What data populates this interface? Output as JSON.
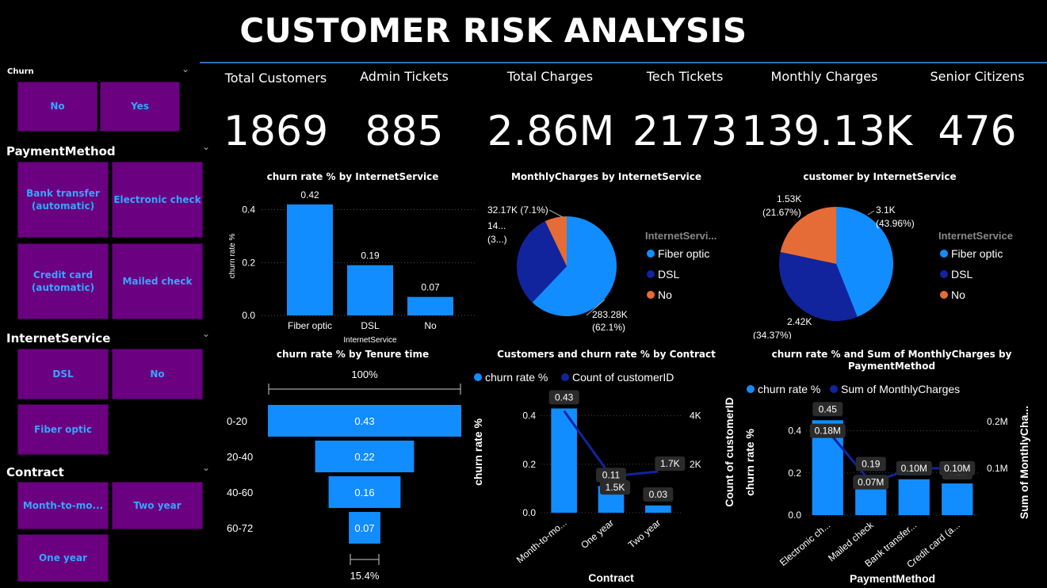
{
  "title": "CUSTOMER RISK ANALYSIS",
  "slicers": {
    "churn": {
      "title": "Churn",
      "items": [
        "No",
        "Yes"
      ]
    },
    "payment": {
      "title": "PaymentMethod",
      "items": [
        "Bank transfer (automatic)",
        "Electronic check",
        "Credit card (automatic)",
        "Mailed check"
      ]
    },
    "internet": {
      "title": "InternetService",
      "items": [
        "DSL",
        "No",
        "Fiber optic"
      ]
    },
    "contract": {
      "title": "Contract",
      "items": [
        "Month-to-mo...",
        "Two year",
        "One year"
      ]
    }
  },
  "kpis": [
    {
      "label": "Total Customers",
      "value": "1869"
    },
    {
      "label": "Admin Tickets",
      "value": "885"
    },
    {
      "label": "Total Charges",
      "value": "2.86M"
    },
    {
      "label": "Tech Tickets",
      "value": "2173"
    },
    {
      "label": "Monthly Charges",
      "value": "139.13K"
    },
    {
      "label": "Senior Citizens",
      "value": "476"
    }
  ],
  "colors": {
    "accent": "#118dff",
    "dark_blue": "#12239e",
    "orange": "#e66c37",
    "slicer_bg": "#6b0080",
    "slicer_text": "#35a6ff",
    "line": "#2f6fb3"
  },
  "chart_data": [
    {
      "type": "bar",
      "title": "churn rate % by InternetService",
      "xlabel": "InternetService",
      "ylabel": "churn rate %",
      "categories": [
        "Fiber optic",
        "DSL",
        "No"
      ],
      "values": [
        0.42,
        0.19,
        0.07
      ],
      "value_labels": [
        "0.42",
        "0.19",
        "0.07"
      ],
      "yticks": [
        "0.0",
        "0.2",
        "0.4"
      ],
      "ylim": [
        0,
        0.45
      ]
    },
    {
      "type": "pie",
      "title": "MonthlyCharges by InternetService",
      "legend_title": "InternetServi...",
      "categories": [
        "Fiber optic",
        "DSL",
        "No"
      ],
      "values": [
        283.28,
        14.0,
        32.17
      ],
      "value_labels": [
        "283.28K (62.1%)",
        "14... (3...)",
        "32.17K (7.1%)"
      ],
      "label_lines": [
        [
          "283.28K",
          "(62.1%)"
        ],
        [
          "14...",
          "(3...)"
        ],
        [
          "32.17K (7.1%)"
        ]
      ],
      "slice_fractions": [
        0.621,
        0.308,
        0.071
      ]
    },
    {
      "type": "pie",
      "title": "customer by InternetService",
      "legend_title": "InternetService",
      "categories": [
        "Fiber optic",
        "DSL",
        "No"
      ],
      "values": [
        3.1,
        2.42,
        1.53
      ],
      "value_labels": [
        "3.1K (43.96%)",
        "2.42K (34.37%)",
        "1.53K (21.67%)"
      ],
      "label_lines": [
        [
          "3.1K",
          "(43.96%)"
        ],
        [
          "2.42K",
          "(34.37%)"
        ],
        [
          "1.53K",
          "(21.67%)"
        ]
      ],
      "slice_fractions": [
        0.4396,
        0.3437,
        0.2167
      ]
    },
    {
      "type": "bar",
      "subtype": "funnel",
      "title": "churn rate % by Tenure time",
      "categories": [
        "0-20",
        "20-40",
        "40-60",
        "60-72"
      ],
      "values": [
        0.43,
        0.22,
        0.16,
        0.07
      ],
      "value_labels": [
        "0.43",
        "0.22",
        "0.16",
        "0.07"
      ],
      "top_label": "100%",
      "bottom_label": "15.4%"
    },
    {
      "type": "bar",
      "subtype": "combo",
      "title": "Customers and churn rate % by Contract",
      "xlabel": "Contract",
      "ylabel": "churn rate %",
      "y2label": "Count of customerID",
      "legend": [
        "churn rate %",
        "Count of customerID"
      ],
      "categories": [
        "Month-to-mo...",
        "One year",
        "Two year"
      ],
      "series": [
        {
          "name": "churn rate %",
          "values": [
            0.43,
            0.11,
            0.03
          ],
          "labels": [
            "0.43",
            "0.11",
            "0.03"
          ]
        },
        {
          "name": "Count of customerID",
          "values": [
            4.2,
            1.5,
            1.7
          ],
          "labels": [
            "",
            "1.5K",
            "1.7K"
          ]
        }
      ],
      "yticks": [
        "0.0",
        "0.2",
        "0.4"
      ],
      "y2ticks": [
        "2K",
        "4K"
      ],
      "ylim": [
        0,
        0.5
      ],
      "y2lim": [
        0,
        5
      ]
    },
    {
      "type": "bar",
      "subtype": "combo",
      "title": "churn rate % and Sum of MonthlyCharges by PaymentMethod",
      "title_lines": [
        "churn rate % and Sum of MonthlyCharges by",
        "PaymentMethod"
      ],
      "xlabel": "PaymentMethod",
      "ylabel": "churn rate %",
      "y2label": "Sum of MonthlyCha...",
      "legend": [
        "churn rate %",
        "Sum of MonthlyCharges"
      ],
      "categories": [
        "Electronic ch...",
        "Mailed check",
        "Bank transfer...",
        "Credit card (a..."
      ],
      "series": [
        {
          "name": "churn rate %",
          "values": [
            0.45,
            0.19,
            0.17,
            0.15
          ],
          "labels": [
            "0.45",
            "0.19",
            "0.17",
            "0.15"
          ]
        },
        {
          "name": "Sum of MonthlyCharges",
          "values": [
            0.18,
            0.07,
            0.1,
            0.1
          ],
          "labels": [
            "0.18M",
            "0.07M",
            "0.10M",
            "0.10M"
          ]
        }
      ],
      "yticks": [
        "0.0",
        "0.2",
        "0.4"
      ],
      "y2ticks": [
        "0.1M",
        "0.2M"
      ],
      "ylim": [
        0,
        0.5
      ],
      "y2lim": [
        0,
        0.225
      ]
    }
  ]
}
